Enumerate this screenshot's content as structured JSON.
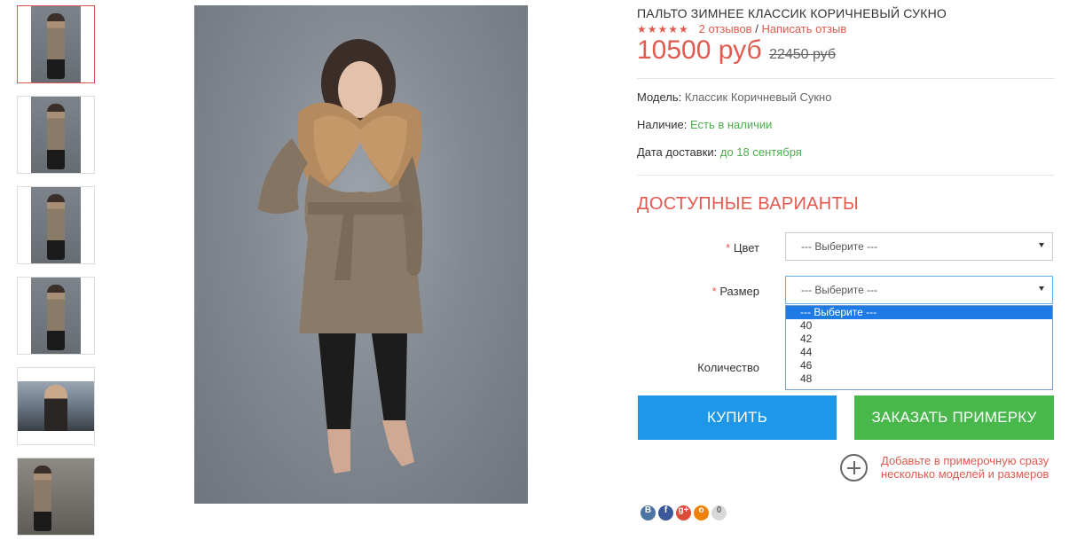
{
  "product": {
    "title": "ПАЛЬТО ЗИМНЕЕ КЛАССИК КОРИЧНЕВЫЙ СУКНО",
    "stars": "★★★★★",
    "reviews_link": "2 отзывов",
    "review_separator": " / ",
    "write_review_link": "Написать отзыв",
    "price_new": "10500 руб",
    "price_old": "22450 руб"
  },
  "meta": {
    "model_label": "Модель:",
    "model_value": "Классик Коричневый Сукно",
    "stock_label": "Наличие:",
    "stock_value": "Есть в наличии",
    "delivery_label": "Дата доставки:",
    "delivery_value": "до 18 сентября"
  },
  "variants": {
    "title": "ДОСТУПНЫЕ ВАРИАНТЫ",
    "required_mark": "*",
    "color_label": "Цвет",
    "color_value": "--- Выберите ---",
    "size_label": "Размер",
    "size_value": "--- Выберите ---",
    "size_options": [
      "--- Выберите ---",
      "40",
      "42",
      "44",
      "46",
      "48"
    ],
    "quantity_label": "Количество"
  },
  "actions": {
    "buy_label": "КУПИТЬ",
    "fitting_label": "ЗАКАЗАТЬ ПРИМЕРКУ",
    "add_fitting_text": "Добавьте в примерочную сразу несколько моделей и размеров"
  },
  "social": [
    {
      "icon": "vk-icon",
      "glyph": "В",
      "color": "#4c75a3"
    },
    {
      "icon": "facebook-icon",
      "glyph": "f",
      "color": "#3b5998"
    },
    {
      "icon": "google-plus-icon",
      "glyph": "g+",
      "color": "#dd4b39"
    },
    {
      "icon": "odnoklassniki-icon",
      "glyph": "о",
      "color": "#ee8208"
    },
    {
      "icon": "share-count-icon",
      "glyph": "0",
      "color": "#d8d8d8"
    }
  ],
  "colors": {
    "accent": "#e05a4f",
    "buy_button": "#1e97e8",
    "fitting_button": "#48b84c",
    "in_stock": "#4cae4c"
  }
}
